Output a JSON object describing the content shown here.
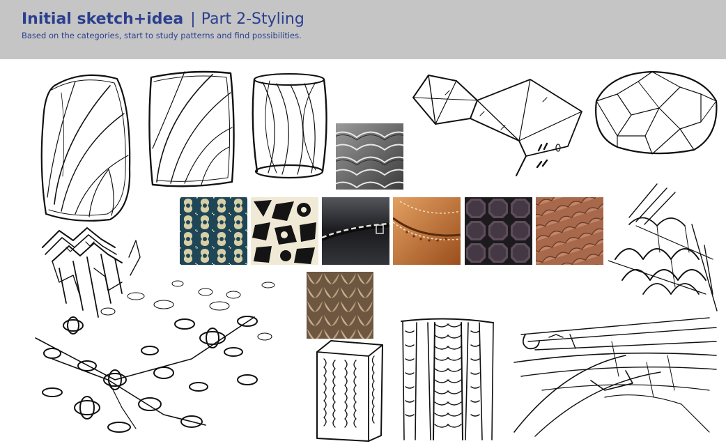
{
  "header": {
    "title_bold": "Initial sketch+idea",
    "separator": "|",
    "title_light": "Part 2-Styling",
    "subtitle": "Based on the categories, start to study patterns and find possibilities."
  },
  "colors": {
    "header_bg": "#c5c5c5",
    "title": "#2b3f8f",
    "ink": "#111111"
  },
  "images": [
    "sketch-leaf-capsule",
    "sketch-leaf-cube",
    "sketch-twisted-cylinder",
    "photo-curved-facade",
    "sketch-faceted-prism",
    "sketch-geodesic-stone",
    "photo-blue-lace-fabric",
    "photo-black-white-geometric-print",
    "photo-stitched-leather",
    "photo-brogue-shoe",
    "photo-octagon-tiles",
    "photo-roof-tiles",
    "sketch-scale-roof",
    "sketch-zigzag-tower",
    "sketch-knot-pattern",
    "photo-knit-wool",
    "sketch-knit-block",
    "sketch-braid-column",
    "sketch-swept-lines"
  ]
}
